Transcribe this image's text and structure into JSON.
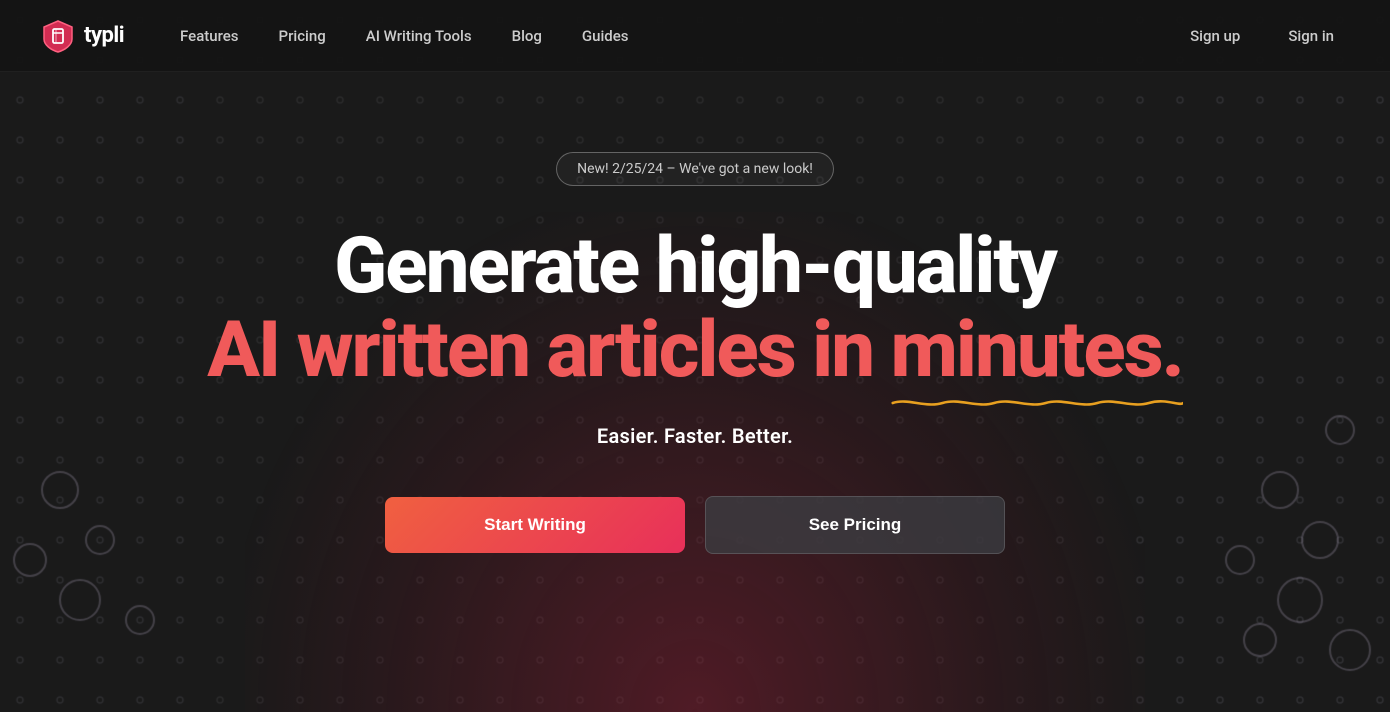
{
  "brand": {
    "name": "typli",
    "icon_label": "typli-logo-icon"
  },
  "nav": {
    "links": [
      {
        "label": "Features",
        "name": "features"
      },
      {
        "label": "Pricing",
        "name": "pricing"
      },
      {
        "label": "AI Writing Tools",
        "name": "ai-writing-tools"
      },
      {
        "label": "Blog",
        "name": "blog"
      },
      {
        "label": "Guides",
        "name": "guides"
      }
    ],
    "signup_label": "Sign up",
    "signin_label": "Sign in"
  },
  "hero": {
    "announcement": "New! 2/25/24 – We've got a new look!",
    "headline_line1": "Generate high-quality",
    "headline_line2": "AI written articles in minutes.",
    "subheadline": "Easier. Faster. Better.",
    "cta_start": "Start Writing",
    "cta_pricing": "See Pricing"
  }
}
